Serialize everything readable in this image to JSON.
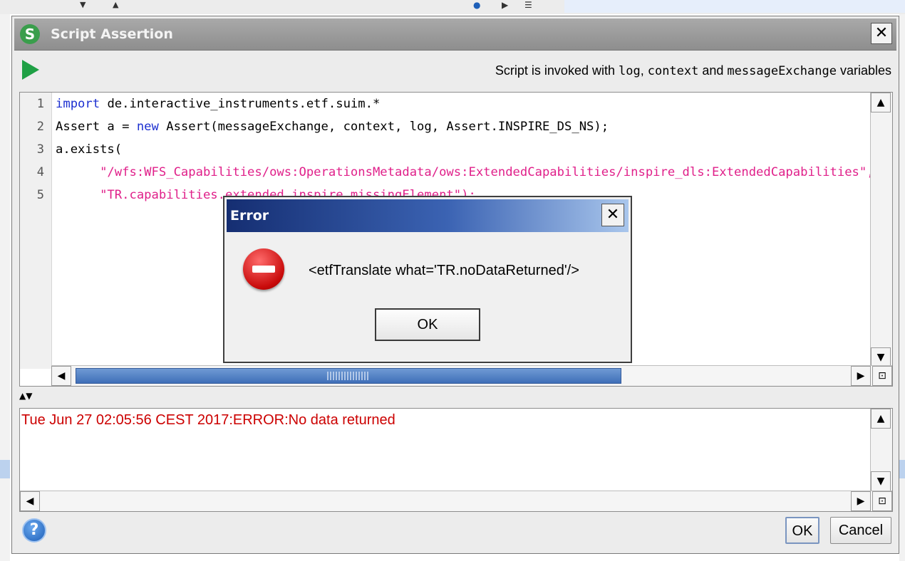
{
  "dialog": {
    "title": "Script Assertion",
    "logo_letter": "S",
    "close_glyph": "✕",
    "info_prefix": "Script is invoked with ",
    "info_var1": "log",
    "info_sep1": ", ",
    "info_var2": "context",
    "info_sep2": " and ",
    "info_var3": "messageExchange",
    "info_suffix": " variables"
  },
  "editor": {
    "line_numbers": [
      "1",
      "2",
      "3",
      "4",
      "5"
    ],
    "lines": {
      "l1_kw": "import",
      "l1_rest": " de.interactive_instruments.etf.suim.*",
      "l2_a": "Assert a = ",
      "l2_kw": "new",
      "l2_b": " Assert(messageExchange, context, log, Assert.INSPIRE_DS_NS);",
      "l3_a": "a.exists(",
      "l4_str": "      \"/wfs:WFS_Capabilities/ows:OperationsMetadata/ows:ExtendedCapabilities/inspire_dls:ExtendedCapabilities\",",
      "l5_str": "      \"TR.capabilities.extended.inspire.missingElement\");"
    }
  },
  "log": {
    "text": "Tue Jun 27 02:05:56 CEST 2017:ERROR:No data returned"
  },
  "error_dialog": {
    "title": "Error",
    "close_glyph": "✕",
    "message": "<etfTranslate what='TR.noDataReturned'/>",
    "ok_label": "OK"
  },
  "footer": {
    "help_glyph": "?",
    "ok_label": "OK",
    "cancel_label": "Cancel"
  },
  "icons": {
    "run": "run-icon",
    "help": "help-icon",
    "stop": "error-stop-icon"
  },
  "colors": {
    "keyword": "#1c2fd0",
    "string": "#e0208a",
    "log_error": "#cc0000",
    "run_green": "#1fa045"
  }
}
